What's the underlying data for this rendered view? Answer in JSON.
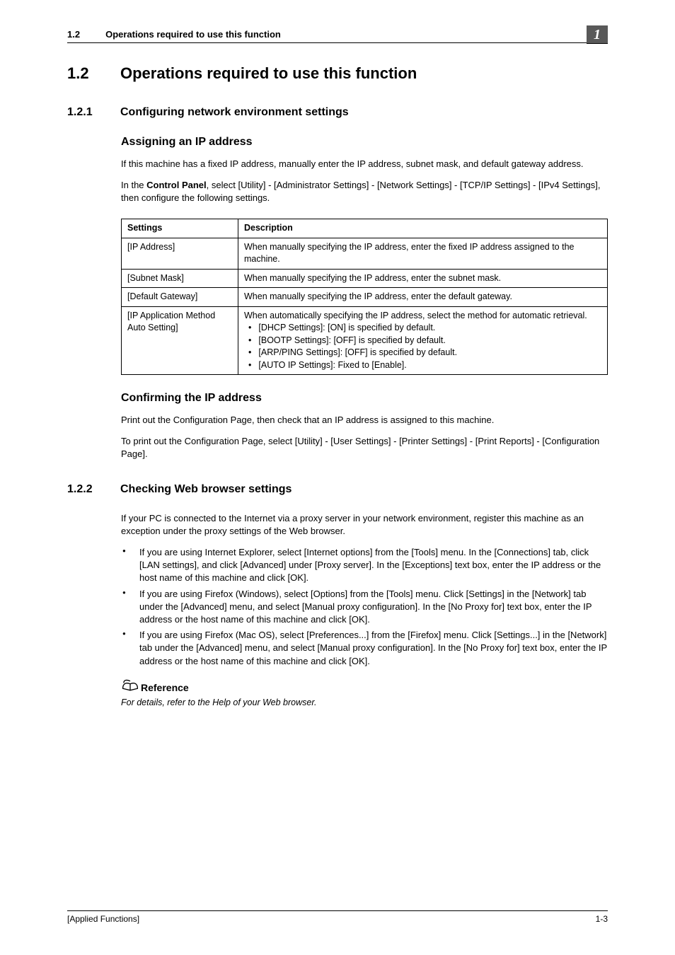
{
  "header": {
    "num": "1.2",
    "title": "Operations required to use this function",
    "badge": "1"
  },
  "h1": {
    "num": "1.2",
    "title": "Operations required to use this function"
  },
  "s1": {
    "num": "1.2.1",
    "title": "Configuring network environment settings",
    "h3a": "Assigning an IP address",
    "p1": "If this machine has a fixed IP address, manually enter the IP address, subnet mask, and default gateway address.",
    "p2_pre": "In the ",
    "p2_bold": "Control Panel",
    "p2_post": ", select [Utility] - [Administrator Settings] - [Network Settings] - [TCP/IP Settings] - [IPv4 Settings], then configure the following settings.",
    "table": {
      "head": {
        "c1": "Settings",
        "c2": "Description"
      },
      "rows": [
        {
          "c1": "[IP Address]",
          "c2": "When manually specifying the IP address, enter the fixed IP address assigned to the machine."
        },
        {
          "c1": "[Subnet Mask]",
          "c2": "When manually specifying the IP address, enter the subnet mask."
        },
        {
          "c1": "[Default Gateway]",
          "c2": "When manually specifying the IP address, enter the default gateway."
        },
        {
          "c1": "[IP Application Method Auto Setting]",
          "c2_intro": "When automatically specifying the IP address, select the method for automatic retrieval.",
          "c2_items": [
            "[DHCP Settings]: [ON] is specified by default.",
            "[BOOTP Settings]: [OFF] is specified by default.",
            "[ARP/PING Settings]: [OFF] is specified by default.",
            "[AUTO IP Settings]: Fixed to [Enable]."
          ]
        }
      ]
    },
    "h3b": "Confirming the IP address",
    "p3": "Print out the Configuration Page, then check that an IP address is assigned to this machine.",
    "p4": "To print out the Configuration Page, select [Utility] - [User Settings] - [Printer Settings] - [Print Reports] - [Configuration Page]."
  },
  "s2": {
    "num": "1.2.2",
    "title": "Checking Web browser settings",
    "p1": "If your PC is connected to the Internet via a proxy server in your network environment, register this machine as an exception under the proxy settings of the Web browser.",
    "items": [
      "If you are using Internet Explorer, select [Internet options] from the [Tools] menu. In the [Connections] tab, click [LAN settings], and click [Advanced] under [Proxy server]. In the [Exceptions] text box, enter the IP address or the host name of this machine and click [OK].",
      "If you are using Firefox (Windows), select [Options] from the [Tools] menu. Click [Settings] in the [Network] tab under the [Advanced] menu, and select [Manual proxy configuration]. In the [No Proxy for] text box, enter the IP address or the host name of this machine and click [OK].",
      "If you are using Firefox (Mac OS), select [Preferences...] from the [Firefox] menu. Click [Settings...] in the [Network] tab under the [Advanced] menu, and select [Manual proxy configuration]. In the [No Proxy for] text box, enter the IP address or the host name of this machine and click [OK]."
    ],
    "ref_label": "Reference",
    "ref_text": "For details, refer to the Help of your Web browser."
  },
  "footer": {
    "left": "[Applied Functions]",
    "right": "1-3"
  }
}
